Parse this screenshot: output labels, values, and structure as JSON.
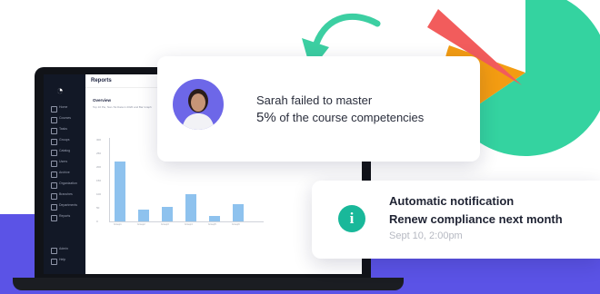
{
  "app": {
    "title": "Reports",
    "overview_title": "Overview",
    "overview_desc": "Top 10 Pie, Non-Tot Data in 2020 and Bar Graph",
    "nav": [
      "Home",
      "Courses",
      "Tasks",
      "Groups",
      "Catalog",
      "Users",
      "Archive",
      "Organization",
      "Branches",
      "Departments",
      "Reports"
    ],
    "bottom_nav": [
      "Admin",
      "Help"
    ],
    "chart_data": {
      "type": "bar",
      "categories": [
        "Group1",
        "Group2",
        "Group3",
        "Group4",
        "Group5",
        "Group6"
      ],
      "values": [
        220,
        45,
        55,
        100,
        20,
        65
      ],
      "ylim": [
        0,
        300
      ],
      "yticks": [
        "300",
        "250",
        "200",
        "150",
        "100",
        "50",
        "0"
      ],
      "ylabel": "",
      "xlabel": "",
      "color": "#8ec2ee"
    }
  },
  "notice_card": {
    "line1": "Sarah failed to master",
    "percent": "5%",
    "line2_rest": "of the course competencies"
  },
  "notification": {
    "icon": "info-icon",
    "title": "Automatic notification",
    "message": "Renew compliance next month",
    "time": "Sept 10, 2:00pm"
  },
  "colors": {
    "band": "#5b53e6",
    "pie_green": "#34d3a0",
    "pie_orange": "#f39c12",
    "pie_red": "#f25c5c",
    "arrow": "#3ccfa2"
  }
}
